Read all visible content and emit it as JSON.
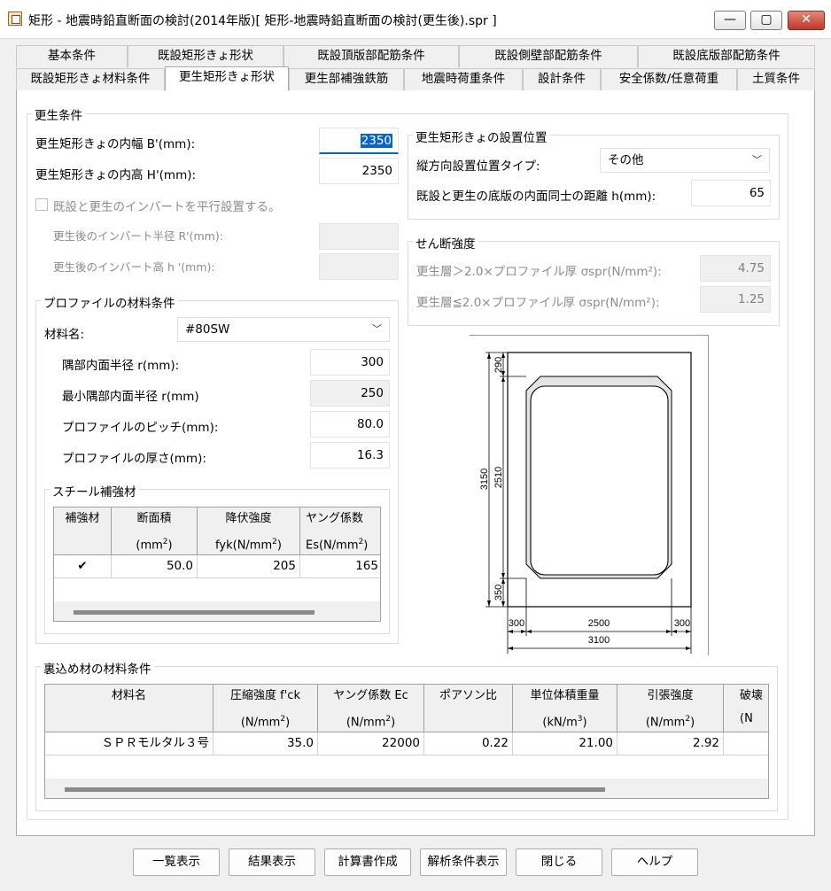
{
  "window": {
    "title": "矩形 - 地震時鉛直断面の検討(2014年版)[ 矩形-地震時鉛直断面の検討(更生後).spr ]",
    "min_glyph": "—",
    "max_glyph": "▢",
    "close_glyph": "✕"
  },
  "tabs_row1": [
    "基本条件",
    "既設矩形きょ形状",
    "既設頂版部配筋条件",
    "既設側壁部配筋条件",
    "既設底版部配筋条件"
  ],
  "tabs_row2": [
    "既設矩形きょ材料条件",
    "更生矩形きょ形状",
    "更生部補強鉄筋",
    "地震時荷重条件",
    "設計条件",
    "安全係数/任意荷重",
    "土質条件"
  ],
  "active_tab": "更生矩形きょ形状",
  "koseijoken": {
    "title": "更生条件",
    "width_label": "更生矩形きょの内幅 B'(mm):",
    "width_value": "2350",
    "height_label": "更生矩形きょの内高 H'(mm):",
    "height_value": "2350",
    "invert_parallel_label": "既設と更生のインバートを平行設置する。",
    "invert_radius_label": "更生後のインバート半径 R'(mm):",
    "invert_height_label": "更生後のインバート高  h '(mm):"
  },
  "install_position": {
    "title": "更生矩形きょの設置位置",
    "type_label": "縦方向設置位置タイプ:",
    "type_value": "その他",
    "distance_label": "既設と更生の底版の内面同士の距離 h(mm):",
    "distance_value": "65"
  },
  "shear": {
    "title": "せん断強度",
    "row1_label": "更生層＞2.0×プロファイル厚 σspr(N/mm²):",
    "row1_value": "4.75",
    "row2_label": "更生層≦2.0×プロファイル厚 σspr(N/mm²):",
    "row2_value": "1.25"
  },
  "profile": {
    "title": "プロファイルの材料条件",
    "material_label": "材料名:",
    "material_value": "#80SW",
    "corner_radius_label": "隅部内面半径 r(mm):",
    "corner_radius_value": "300",
    "min_corner_radius_label": "最小隅部内面半径 r(mm)",
    "min_corner_radius_value": "250",
    "pitch_label": "プロファイルのピッチ(mm):",
    "pitch_value": "80.0",
    "thickness_label": "プロファイルの厚さ(mm):",
    "thickness_value": "16.3"
  },
  "steel": {
    "title": "スチール補強材",
    "headers": [
      {
        "l1": "補強材",
        "l2": ""
      },
      {
        "l1": "断面積",
        "l2": "(mm",
        "sup": "2",
        "l3": ")"
      },
      {
        "l1": "降伏強度",
        "l2": "fyk(N/mm",
        "sup": "2",
        "l3": ")"
      },
      {
        "l1": "ヤング係数",
        "l2": "Es(N/mm",
        "sup": "2",
        "l3": ")"
      }
    ],
    "row": {
      "checked": "✔",
      "area": "50.0",
      "fyk": "205",
      "es": "165"
    }
  },
  "backfill": {
    "title": "裏込め材の材料条件",
    "headers": [
      {
        "l1": "材料名",
        "l2": ""
      },
      {
        "l1": "圧縮強度 f'ck",
        "l2": "(N/mm",
        "sup": "2",
        "l3": ")"
      },
      {
        "l1": "ヤング係数 Ec",
        "l2": "(N/mm",
        "sup": "2",
        "l3": ")"
      },
      {
        "l1": "ポアソン比",
        "l2": ""
      },
      {
        "l1": "単位体積重量",
        "l2": "(kN/m",
        "sup": "3",
        "l3": ")"
      },
      {
        "l1": "引張強度",
        "l2": "(N/mm",
        "sup": "2",
        "l3": ")"
      },
      {
        "l1": "破壊",
        "l2": "(N"
      }
    ],
    "row": [
      "ＳＰＲモルタル３号",
      "35.0",
      "22000",
      "0.22",
      "21.00",
      "2.92",
      ""
    ]
  },
  "diagram": {
    "dim_top": "290",
    "dim_inner": "2510",
    "dim_outer": "3150",
    "dim_bottom": "350",
    "dim_left": "300",
    "dim_center": "2500",
    "dim_right": "300",
    "dim_total": "3100"
  },
  "buttons": [
    "一覧表示",
    "結果表示",
    "計算書作成",
    "解析条件表示",
    "閉じる",
    "ヘルプ"
  ]
}
